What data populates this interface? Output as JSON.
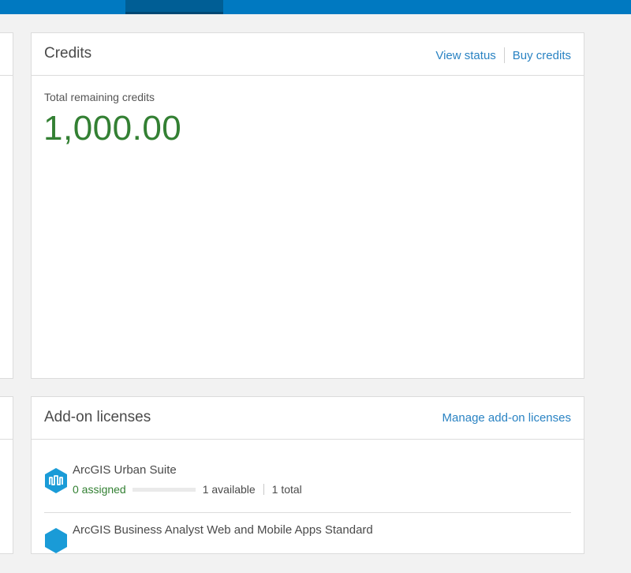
{
  "credits": {
    "title": "Credits",
    "view_status": "View status",
    "buy_credits": "Buy credits",
    "remaining_label": "Total remaining credits",
    "remaining_value": "1,000.00"
  },
  "addons": {
    "title": "Add-on licenses",
    "manage_link": "Manage add-on licenses",
    "items": [
      {
        "name": "ArcGIS Urban Suite",
        "assigned": "0 assigned",
        "assigned_fraction": 0,
        "available": "1 available",
        "total": "1 total",
        "icon": "arcgis-urban-icon"
      },
      {
        "name": "ArcGIS Business Analyst Web and Mobile Apps Standard",
        "icon": "business-analyst-icon"
      }
    ]
  },
  "colors": {
    "topbar": "#0079c1",
    "link": "#2a83c3",
    "credit_green": "#338033"
  }
}
